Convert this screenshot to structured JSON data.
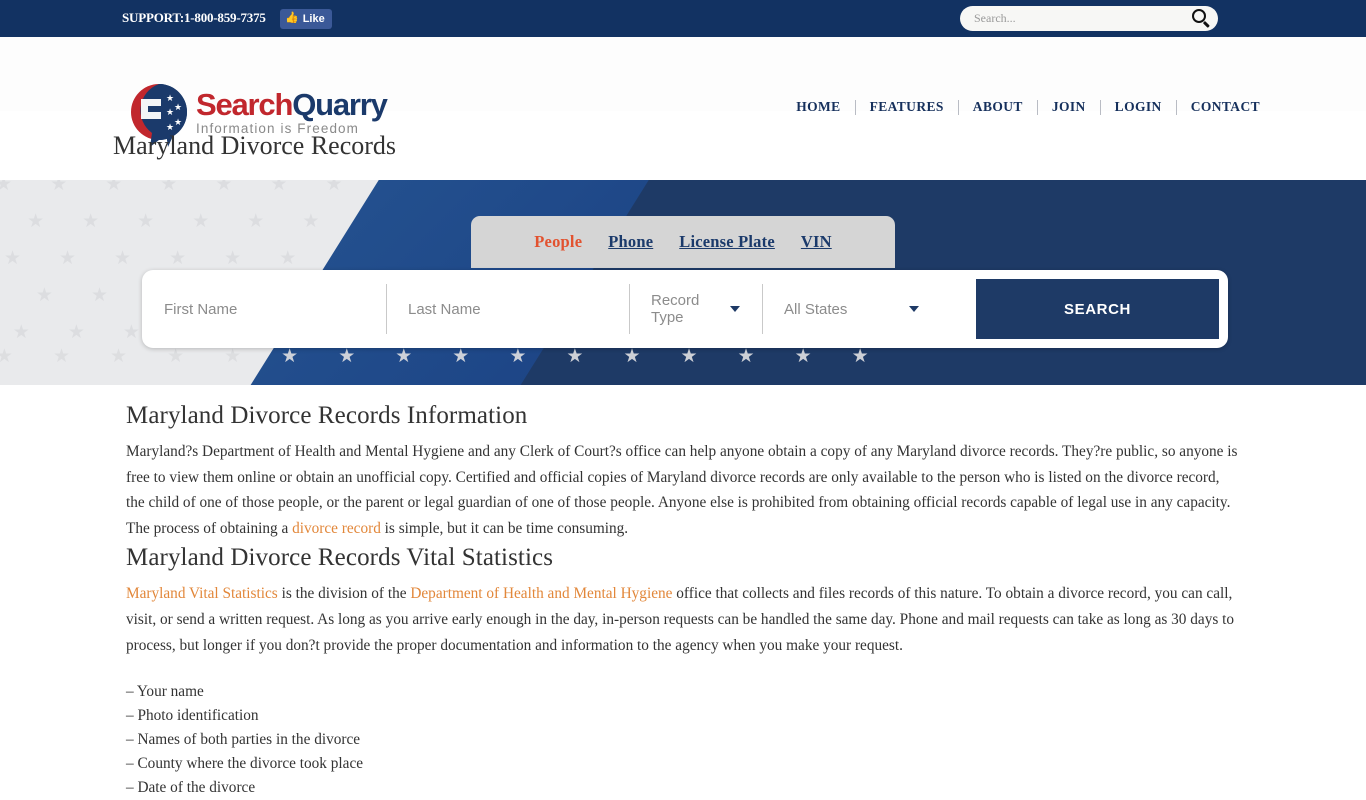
{
  "topbar": {
    "support": "SUPPORT:1-800-859-7375",
    "like_label": "Like",
    "like_icon": "thumbs-up-icon",
    "search_placeholder": "Search...",
    "search_value": "",
    "search_icon": "search-icon",
    "bg_color": "#123262"
  },
  "header": {
    "logo": {
      "name_part1": "Search",
      "name_part2": "Quarry",
      "tagline": "Information is Freedom",
      "color_red": "#c1272d",
      "color_navy": "#1b3a6b"
    },
    "nav": [
      {
        "label": "HOME"
      },
      {
        "label": "FEATURES"
      },
      {
        "label": "ABOUT"
      },
      {
        "label": "JOIN"
      },
      {
        "label": "LOGIN"
      },
      {
        "label": "CONTACT"
      }
    ]
  },
  "page": {
    "title": "Maryland Divorce Records"
  },
  "hero": {
    "bg_color": "#1e3a66",
    "tabs": [
      {
        "label": "People",
        "active": true
      },
      {
        "label": "Phone",
        "active": false
      },
      {
        "label": "License Plate",
        "active": false
      },
      {
        "label": "VIN",
        "active": false
      }
    ],
    "form": {
      "first_name_placeholder": "First Name",
      "first_name_value": "",
      "last_name_placeholder": "Last Name",
      "last_name_value": "",
      "record_type_label": "Record Type",
      "state_label": "All States",
      "search_button": "SEARCH",
      "button_color": "#1e3a66"
    }
  },
  "main": {
    "heading1": "Maryland Divorce Records Information",
    "para1_a": "Maryland?s Department of Health and Mental Hygiene and any Clerk of Court?s office can help anyone obtain a copy of any Maryland divorce records. They?re public, so anyone is free to view them online or obtain an unofficial copy. Certified and official copies of Maryland divorce records are only available to the person who is listed on the divorce record, the child of one of those people, or the parent or legal guardian of one of those people. Anyone else is prohibited from obtaining official records capable of legal use in any capacity. The process of obtaining a ",
    "para1_link": "divorce record",
    "para1_b": " is simple, but it can be time consuming.",
    "heading2": "Maryland Divorce Records Vital Statistics",
    "para2_link1": "Maryland Vital Statistics",
    "para2_a": " is the division of the ",
    "para2_link2": "Department of Health and Mental Hygiene",
    "para2_b": " office that collects and files records of this nature. To obtain a divorce record, you can call, visit, or send a written request. As long as you arrive early enough in the day, in-person requests can be handled the same day. Phone and mail requests can take as long as 30 days to process, but longer if you don?t provide the proper documentation and information to the agency when you make your request.",
    "link_color": "#e2873a",
    "bullets": [
      "– Your name",
      "– Photo identification",
      "– Names of both parties in the divorce",
      "– County where the divorce took place",
      "– Date of the divorce"
    ]
  }
}
